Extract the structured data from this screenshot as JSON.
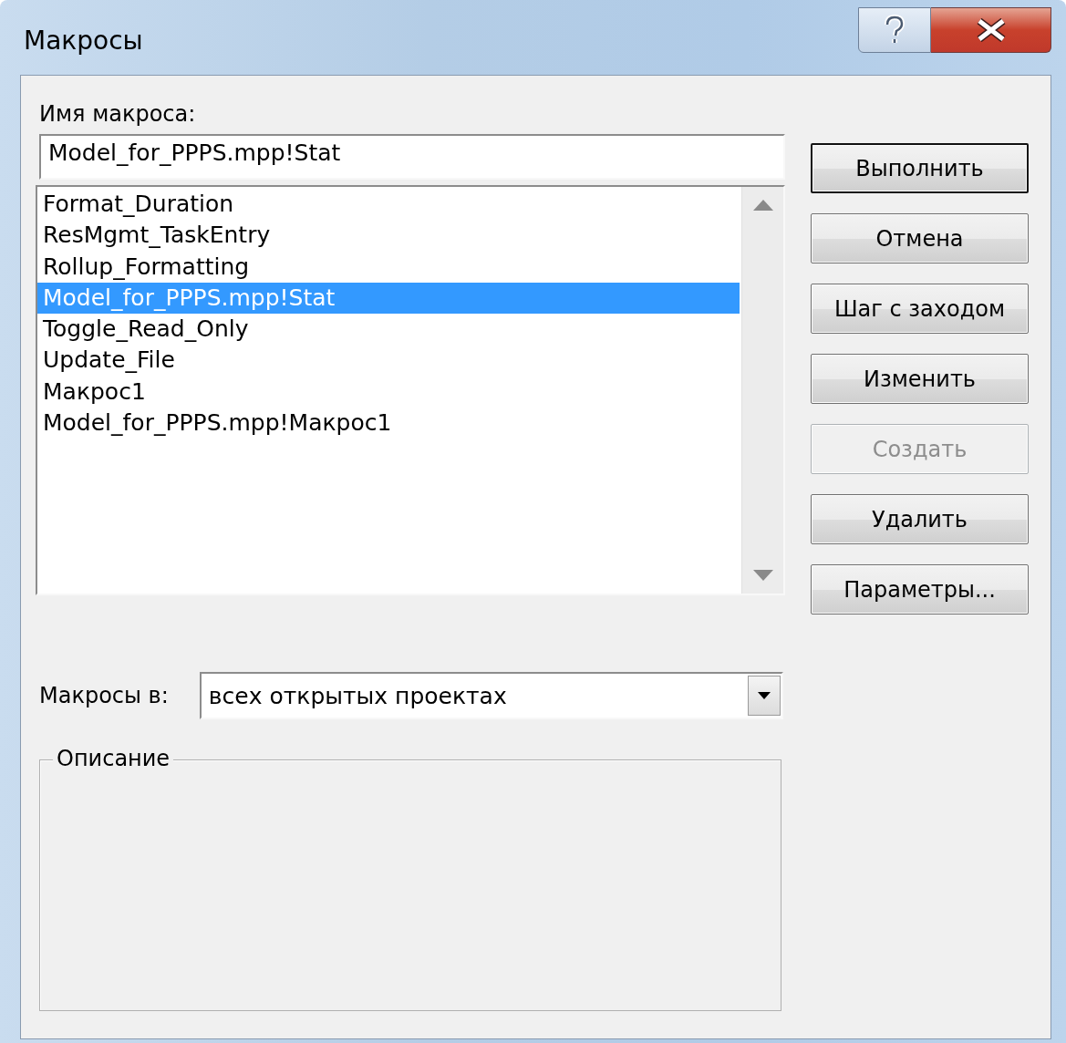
{
  "window": {
    "title": "Макросы"
  },
  "name_label": {
    "text": "Имя макроса:"
  },
  "name_field": {
    "value": "Model_for_PPPS.mpp!Stat"
  },
  "macros": [
    {
      "label": "Format_Duration",
      "selected": false
    },
    {
      "label": "ResMgmt_TaskEntry",
      "selected": false
    },
    {
      "label": "Rollup_Formatting",
      "selected": false
    },
    {
      "label": "Model_for_PPPS.mpp!Stat",
      "selected": true
    },
    {
      "label": "Toggle_Read_Only",
      "selected": false
    },
    {
      "label": "Update_File",
      "selected": false
    },
    {
      "label": "Макрос1",
      "selected": false
    },
    {
      "label": "Model_for_PPPS.mpp!Макрос1",
      "selected": false
    }
  ],
  "buttons": [
    {
      "label": "Выполнить",
      "default": true,
      "disabled": false
    },
    {
      "label": "Отмена",
      "default": false,
      "disabled": false
    },
    {
      "label": "Шаг с заходом",
      "default": false,
      "disabled": false
    },
    {
      "label": "Изменить",
      "default": false,
      "disabled": false
    },
    {
      "label": "Создать",
      "default": false,
      "disabled": true
    },
    {
      "label": "Удалить",
      "default": false,
      "disabled": false
    },
    {
      "label": "Параметры...",
      "default": false,
      "disabled": false
    }
  ],
  "macros_in": {
    "label": "Макросы в:",
    "value": "всех открытых проектах"
  },
  "description": {
    "title": "Описание"
  }
}
